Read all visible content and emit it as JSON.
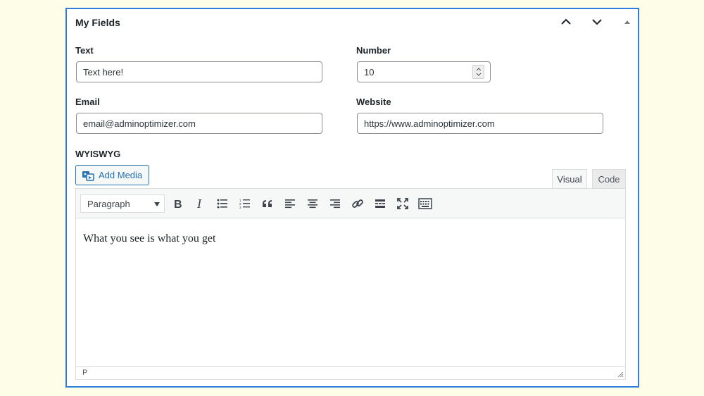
{
  "panel": {
    "title": "My Fields",
    "move_up_icon": "chevron-up-icon",
    "move_down_icon": "chevron-down-icon",
    "toggle_icon": "triangle-up-icon"
  },
  "fields": {
    "text": {
      "label": "Text",
      "value": "Text here!"
    },
    "number": {
      "label": "Number",
      "value": "10"
    },
    "email": {
      "label": "Email",
      "value": "email@adminoptimizer.com"
    },
    "website": {
      "label": "Website",
      "value": "https://www.adminoptimizer.com"
    }
  },
  "wysiwyg": {
    "label": "WYISWYG",
    "add_media_label": "Add Media",
    "tabs": [
      "Visual",
      "Code"
    ],
    "active_tab": "Visual",
    "format_value": "Paragraph",
    "toolbar_icons": [
      "bold-icon",
      "italic-icon",
      "bulleted-list-icon",
      "numbered-list-icon",
      "blockquote-icon",
      "align-left-icon",
      "align-center-icon",
      "align-right-icon",
      "link-icon",
      "read-more-icon",
      "fullscreen-icon",
      "toolbar-toggle-icon"
    ],
    "content": "What you see is what you get",
    "path": "P"
  },
  "colors": {
    "accent": "#2271b1",
    "panel_border": "#2e7ddc",
    "page_background": "#fdfde8"
  }
}
